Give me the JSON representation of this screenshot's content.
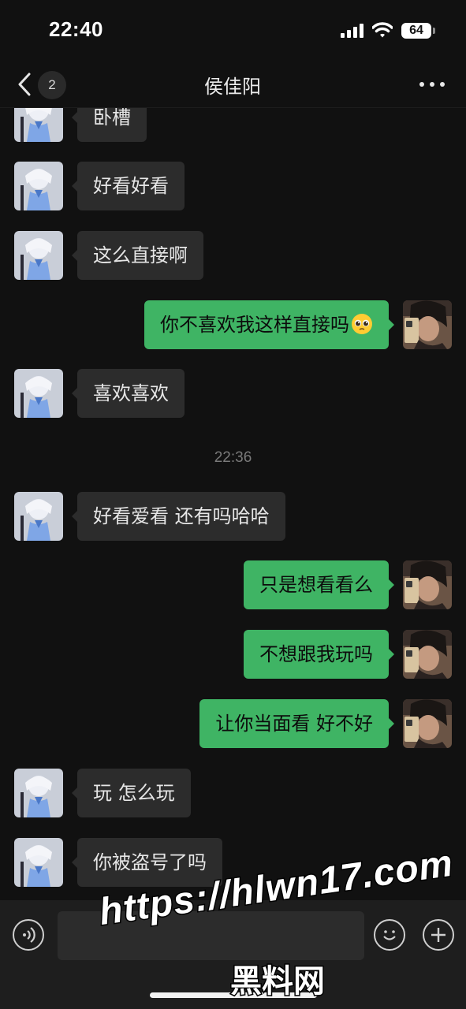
{
  "status_bar": {
    "time": "22:40",
    "battery_level": "64",
    "icons": [
      "signal-icon",
      "wifi-icon",
      "battery-icon"
    ]
  },
  "nav": {
    "back_icon": "chevron-left-icon",
    "unread_count": "2",
    "title": "侯佳阳",
    "more_icon": "more-dots-icon"
  },
  "messages": [
    {
      "side": "in",
      "text": "卧槽"
    },
    {
      "side": "in",
      "text": "好看好看"
    },
    {
      "side": "in",
      "text": "这么直接啊"
    },
    {
      "side": "out",
      "text": "你不喜欢我这样直接吗",
      "emoji": "pleading-face-emoji"
    },
    {
      "side": "in",
      "text": "喜欢喜欢"
    },
    {
      "side": "in",
      "text": "好看爱看 还有吗哈哈"
    },
    {
      "side": "out",
      "text": "只是想看看么"
    },
    {
      "side": "out",
      "text": "不想跟我玩吗"
    },
    {
      "side": "out",
      "text": "让你当面看 好不好"
    },
    {
      "side": "in",
      "text": "玩 怎么玩"
    },
    {
      "side": "in",
      "text": "你被盗号了吗"
    }
  ],
  "timestamp": "22:36",
  "input_bar": {
    "voice_icon": "voice-icon",
    "message_value": "",
    "emoji_icon": "emoji-icon",
    "plus_icon": "plus-icon"
  },
  "watermark": {
    "line1": "https://hlwn17.com",
    "line2": "黑料网"
  },
  "colors": {
    "background": "#111111",
    "incoming_bubble": "#2c2c2c",
    "outgoing_bubble": "#3fb464",
    "timestamp": "#7a7a7a"
  }
}
